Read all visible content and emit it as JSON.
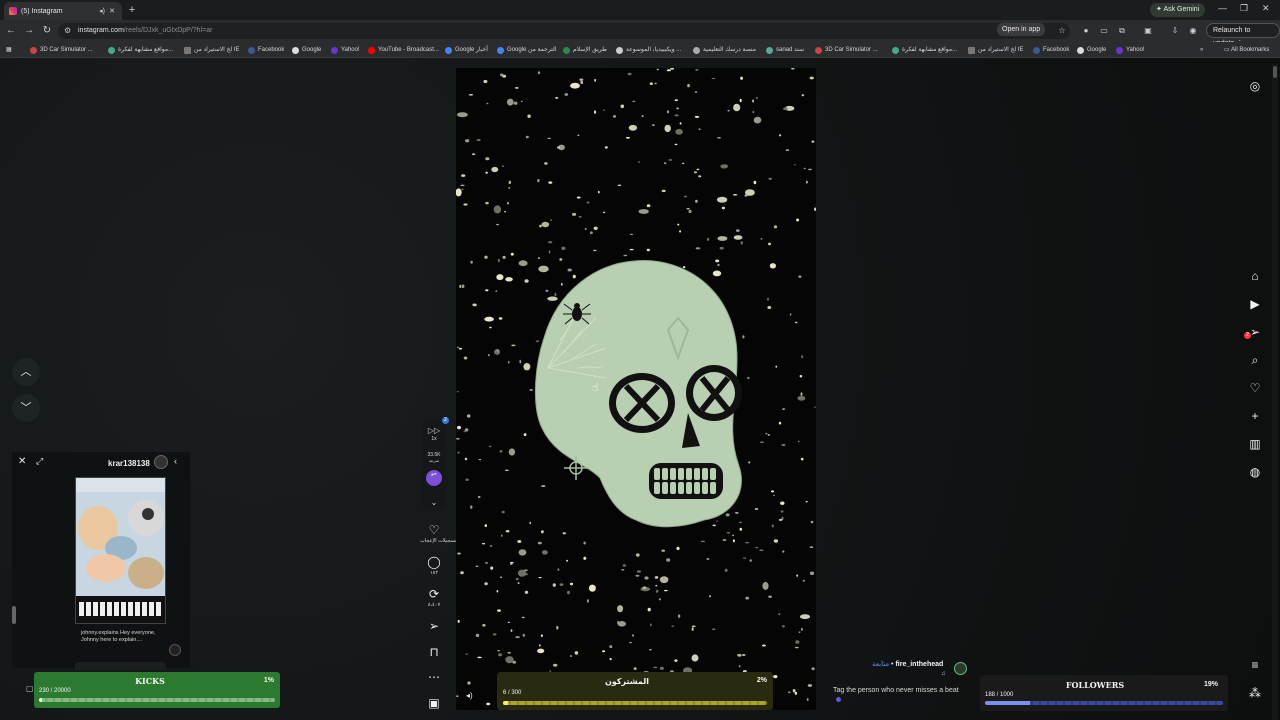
{
  "browser": {
    "tab_title": "(5) Instagram",
    "url_host": "instagram.com",
    "url_path": "/reels/DJxk_uGtxDpP/?hl=ar",
    "ask_gemini": "Ask Gemini",
    "open_in_app": "Open in app",
    "relaunch": "Relaunch to update",
    "all_bookmarks": "All Bookmarks",
    "bookmarks": [
      "3D Car Simulator ...",
      "مواقع مشابهة لفكرة...",
      "لخ الاستيراد من IE",
      "Facebook",
      "Google",
      "Yahoo!",
      "YouTube - Broadcast...",
      "Google أخبار",
      "Google الترجمة من",
      "طريق الإسلام",
      "ويكيبيديا، الموسوعة ...",
      "منصة درسك التعليمية",
      "sanad سند",
      "3D Car Simulator ...",
      "مواقع مشابهة لفكرة...",
      "لخ الاستيراد من IE",
      "Facebook",
      "Google",
      "Yahoo!"
    ]
  },
  "actions": {
    "speed": "1x",
    "views": "33.5K",
    "views_unit": "سرعة",
    "purple_label": "جو",
    "blue_badge": "2",
    "likes_label": "تسجيلات الإعجاب",
    "comments_count": "١٨٢",
    "reposts_count": "٨،٤٠٧"
  },
  "mini_player": {
    "username": "krar138138",
    "caption": "johnny.explains Hey everyone, Johnny here to explain...."
  },
  "kicks": {
    "title": "KICKS",
    "percent": "1%",
    "count": "230 / 20000",
    "progress": 0.0115
  },
  "subscribers": {
    "title": "المشتركون",
    "percent": "2%",
    "count": "6 / 300",
    "progress": 0.02
  },
  "followers": {
    "title": "FOLLOWERS",
    "percent": "19%",
    "count": "188 / 1000",
    "progress": 0.188
  },
  "post": {
    "follow_label": "متابعة",
    "separator": "•",
    "author": "fire_inthehead",
    "music_note": "♫",
    "caption": "Tag the person who never misses a beat"
  },
  "notifications": {
    "count": "2"
  },
  "colors": {
    "kicks_bg": "#2c7a2f",
    "subs_bg": "#2a2a10",
    "followers_bar": "#7c8ff0",
    "skull": "#b9cfb1"
  }
}
